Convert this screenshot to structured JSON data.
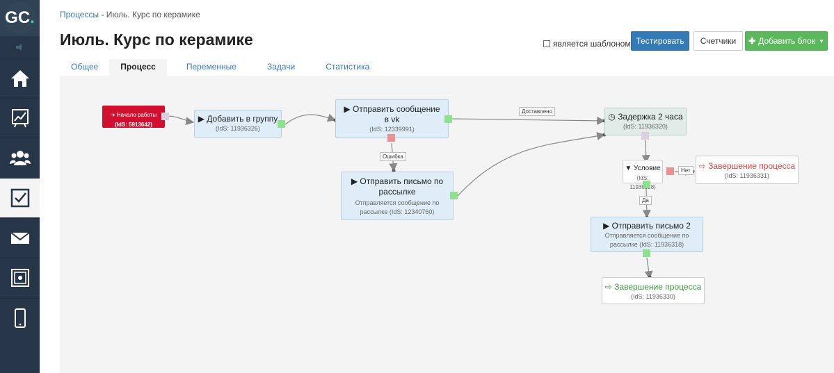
{
  "logo": {
    "text": "GC",
    "accent": "."
  },
  "breadcrumb": {
    "parent": "Процессы",
    "separator": " - ",
    "current": "Июль. Курс по керамике"
  },
  "title": "Июль. Курс по керамике",
  "template_checkbox": {
    "label": "является шаблоном",
    "checked": false
  },
  "buttons": {
    "test": "Тестировать",
    "counters": "Счетчики",
    "add_block": "Добавить блок"
  },
  "tabs": [
    {
      "label": "Общее",
      "active": false
    },
    {
      "label": "Процесс",
      "active": true
    },
    {
      "label": "Переменные",
      "active": false
    },
    {
      "label": "Задачи",
      "active": false
    },
    {
      "label": "Статистика",
      "active": false
    }
  ],
  "sidebar": {
    "items": [
      "home-icon",
      "chart-icon",
      "users-icon",
      "tasks-icon",
      "mail-icon",
      "safe-icon",
      "mobile-icon"
    ],
    "active": "tasks-icon"
  },
  "nodes": {
    "start": {
      "title": "Начало работы",
      "sub": "(IdS: 5913642)"
    },
    "add_group": {
      "title": "Добавить в группу",
      "sub": "(IdS: 11936326)"
    },
    "send_vk": {
      "title": "Отправить сообщение в vk",
      "sub": "(IdS: 12339991)"
    },
    "send_mail": {
      "title": "Отправить письмо по рассылке",
      "sub": "Отправляется сообщение по рассылке (IdS: 12340760)"
    },
    "delay": {
      "title": "Задержка 2 часа",
      "sub": "(IdS: 11936320)"
    },
    "condition": {
      "title": "Условие",
      "sub": "(IdS: 11936328)"
    },
    "end_no": {
      "title": "Завершение процесса",
      "sub": "(IdS: 11936331)"
    },
    "send_mail2": {
      "title": "Отправить письмо 2",
      "sub": "Отправляется сообщение по рассылке (IdS: 11936318)"
    },
    "end_yes": {
      "title": "Завершение процесса",
      "sub": "(IdS: 11936330)"
    }
  },
  "wire_labels": {
    "delivered": "Доставлено",
    "error": "Ошибка",
    "no": "Нет",
    "yes": "Да"
  },
  "colors": {
    "accent": "#38c6b8",
    "primary": "#337ab7",
    "success": "#5cb85c",
    "danger": "#d0102e",
    "end_red": "#e03c3c",
    "end_green": "#3a9a3a"
  }
}
